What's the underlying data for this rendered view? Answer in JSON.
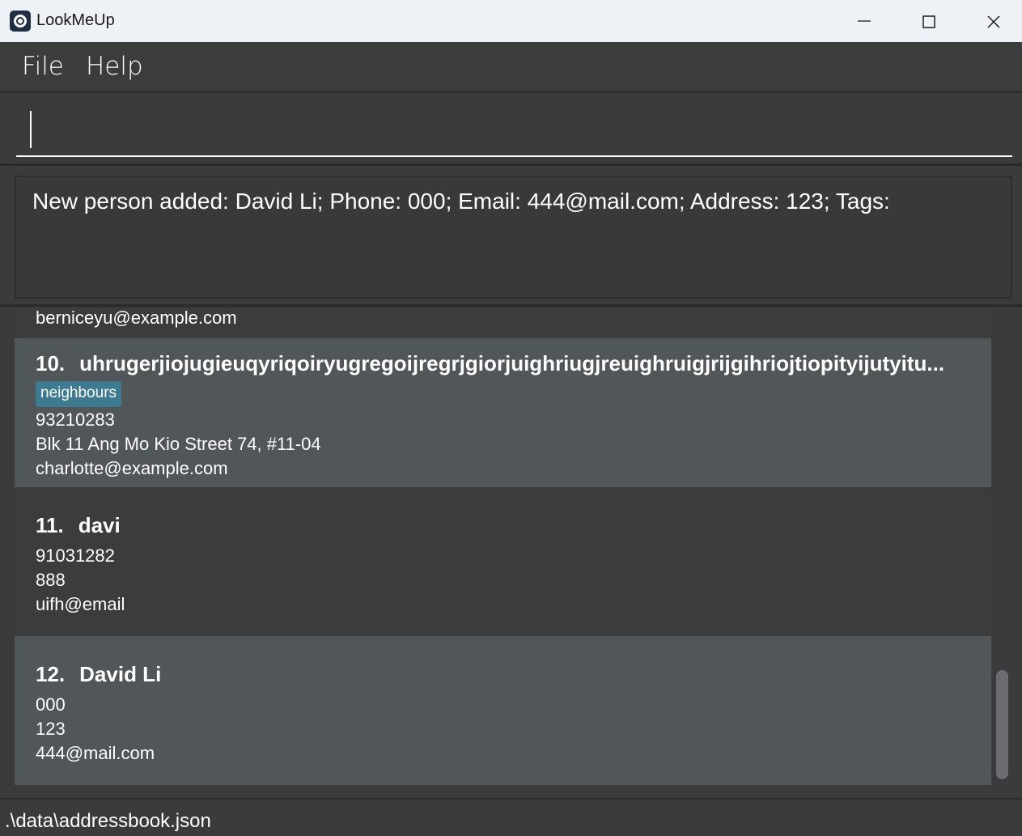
{
  "window": {
    "title": "LookMeUp",
    "icon": "app-eye-icon"
  },
  "menu": {
    "file": "File",
    "help": "Help"
  },
  "command": {
    "value": ""
  },
  "result": {
    "message": "New person added: David Li; Phone: 000; Email: 444@mail.com; Address: 123; Tags:"
  },
  "persons": {
    "partial_email": "berniceyu@example.com",
    "items": [
      {
        "index": "10.",
        "name": "uhrugerjiojugieuqyriqoiryugregoijregrjgiorjuighriugjreuighruigjrijgihriojtiopityijutyitu...",
        "tags": [
          "neighbours"
        ],
        "phone": "93210283",
        "address": "Blk 11 Ang Mo Kio Street 74, #11-04",
        "email": "charlotte@example.com"
      },
      {
        "index": "11.",
        "name": "davi",
        "tags": [],
        "phone": "91031282",
        "address": "888",
        "email": "uifh@email"
      },
      {
        "index": "12.",
        "name": "David Li",
        "tags": [],
        "phone": "000",
        "address": "123",
        "email": "444@mail.com"
      }
    ]
  },
  "status": {
    "path": ".\\data\\addressbook.json"
  },
  "colors": {
    "background": "#3b3b3b",
    "card_light": "#515658",
    "card_dark": "#3c3c3c",
    "tag": "#3e7b91",
    "titlebar": "#eef1f6"
  }
}
